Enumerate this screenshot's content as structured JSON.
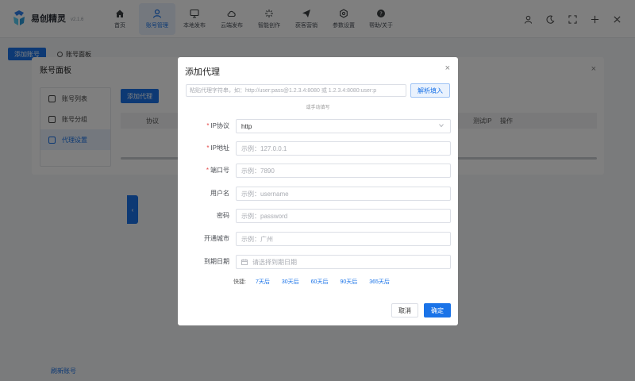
{
  "app": {
    "name": "易创精灵",
    "version": "v2.1.6"
  },
  "nav": [
    {
      "label": "首页",
      "icon": "home-icon",
      "active": false
    },
    {
      "label": "账号管理",
      "icon": "user-icon",
      "active": true
    },
    {
      "label": "本地发布",
      "icon": "monitor-icon",
      "active": false
    },
    {
      "label": "云端发布",
      "icon": "cloud-icon",
      "active": false
    },
    {
      "label": "智能创作",
      "icon": "sparkle-icon",
      "active": false
    },
    {
      "label": "获客营销",
      "icon": "send-icon",
      "active": false
    },
    {
      "label": "参数设置",
      "icon": "gear-icon",
      "active": false
    },
    {
      "label": "帮助/关于",
      "icon": "help-icon",
      "active": false
    }
  ],
  "background": {
    "add_account": "添加账号",
    "panel_tab": "账号面板",
    "footer_link": "刷新账号"
  },
  "account_panel": {
    "title": "账号面板",
    "close": "×",
    "side_items": [
      "账号列表",
      "账号分组",
      "代理设置"
    ],
    "add_proxy": "添加代理",
    "columns": [
      "协议",
      "测试IP",
      "操作"
    ]
  },
  "modal": {
    "title": "添加代理",
    "close": "×",
    "paste_placeholder": "粘贴代理字符串，如：http://user:pass@1.2.3.4:8080 或 1.2.3.4:8080:user:p",
    "parse_button": "解析填入",
    "manual_hint": "或手动填写",
    "fields": {
      "protocol": {
        "label": "IP协议",
        "value": "http",
        "required": true
      },
      "ip": {
        "label": "IP地址",
        "placeholder": "示例：127.0.0.1",
        "required": true
      },
      "port": {
        "label": "端口号",
        "placeholder": "示例：7890",
        "required": true
      },
      "username": {
        "label": "用户名",
        "placeholder": "示例：username",
        "required": false
      },
      "password": {
        "label": "密码",
        "placeholder": "示例：password",
        "required": false
      },
      "city": {
        "label": "开通城市",
        "placeholder": "示例：广州",
        "required": false
      },
      "expiry": {
        "label": "到期日期",
        "placeholder": "请选择到期日期",
        "required": false
      }
    },
    "quick": {
      "label": "快捷:",
      "options": [
        "7天后",
        "30天后",
        "60天后",
        "90天后",
        "365天后"
      ]
    },
    "cancel": "取消",
    "confirm": "确定"
  },
  "colors": {
    "primary": "#1a73e8",
    "required": "#e54545"
  }
}
